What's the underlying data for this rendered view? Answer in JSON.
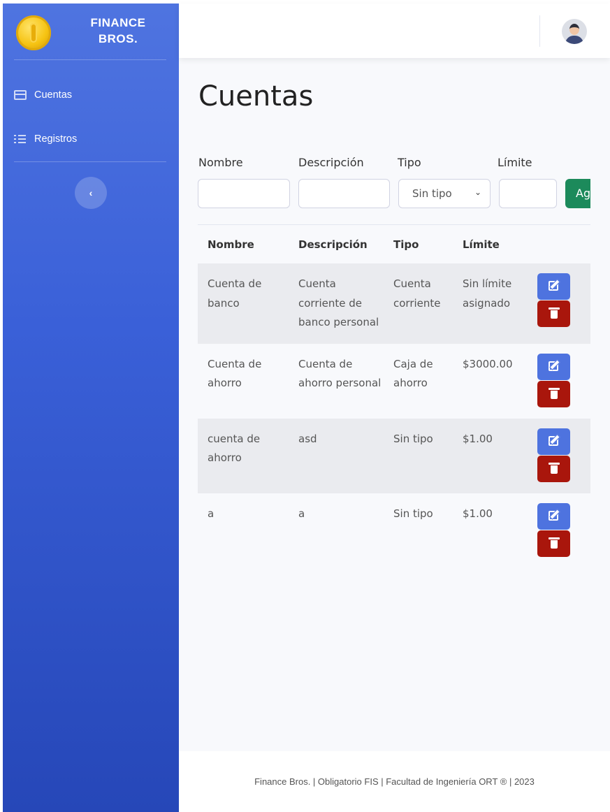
{
  "brand": {
    "line1": "FINANCE",
    "line2": "BROS."
  },
  "sidebar": {
    "items": [
      {
        "label": "Cuentas",
        "icon": "credit-card-icon"
      },
      {
        "label": "Registros",
        "icon": "list-icon"
      }
    ],
    "toggle_symbol": "‹"
  },
  "page": {
    "title": "Cuentas"
  },
  "form": {
    "labels": {
      "nombre": "Nombre",
      "descripcion": "Descripción",
      "tipo": "Tipo",
      "limite": "Límite"
    },
    "values": {
      "nombre": "",
      "descripcion": "",
      "limite": ""
    },
    "tipo_selected": "Sin tipo",
    "add_button": "Agregar"
  },
  "table": {
    "headers": [
      "Nombre",
      "Descripción",
      "Tipo",
      "Límite"
    ],
    "rows": [
      {
        "nombre": "Cuenta de banco",
        "descripcion": "Cuenta corriente de banco personal",
        "tipo": "Cuenta corriente",
        "limite": "Sin límite asignado"
      },
      {
        "nombre": "Cuenta de ahorro",
        "descripcion": "Cuenta de ahorro personal",
        "tipo": "Caja de ahorro",
        "limite": "$3000.00"
      },
      {
        "nombre": "cuenta de ahorro",
        "descripcion": "asd",
        "tipo": "Sin tipo",
        "limite": "$1.00"
      },
      {
        "nombre": "a",
        "descripcion": "a",
        "tipo": "Sin tipo",
        "limite": "$1.00"
      }
    ]
  },
  "footer": {
    "text": "Finance Bros. | Obligatorio FIS | Facultad de Ingeniería ORT ® | 2023"
  },
  "colors": {
    "sidebar_top": "#4f74e0",
    "sidebar_bottom": "#2647b8",
    "edit": "#4e73df",
    "delete": "#a9160c",
    "add": "#1c8a5b"
  }
}
